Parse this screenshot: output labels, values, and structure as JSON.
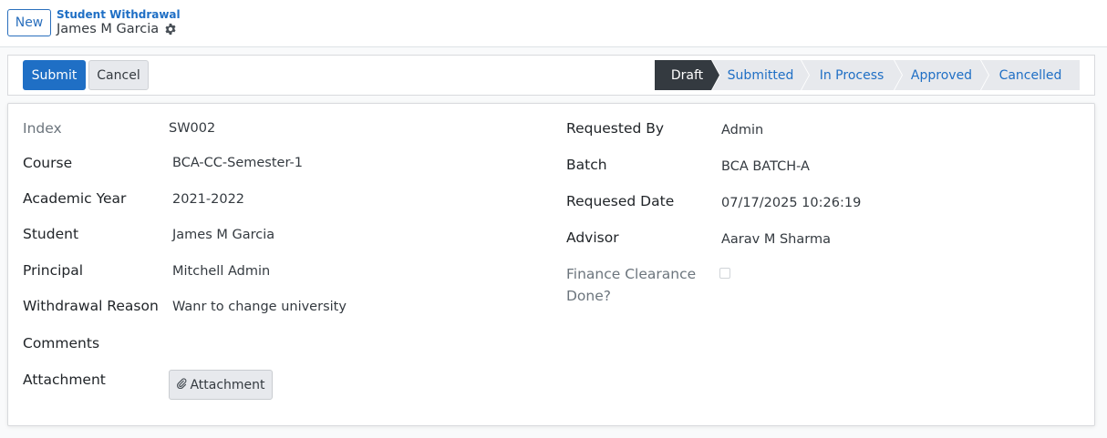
{
  "header": {
    "new_label": "New",
    "breadcrumb": "Student Withdrawal",
    "record_title": "James M Garcia"
  },
  "actions": {
    "submit_label": "Submit",
    "cancel_label": "Cancel"
  },
  "stages": [
    "Draft",
    "Submitted",
    "In Process",
    "Approved",
    "Cancelled"
  ],
  "active_stage": "Draft",
  "form": {
    "left": {
      "index_label": "Index",
      "index_value": "SW002",
      "course_label": "Course",
      "course_value": "BCA-CC-Semester-1",
      "year_label": "Academic Year",
      "year_value": "2021-2022",
      "student_label": "Student",
      "student_value": "James M Garcia",
      "principal_label": "Principal",
      "principal_value": "Mitchell Admin",
      "reason_label": "Withdrawal Reason",
      "reason_value": "Wanr to change university",
      "comments_label": "Comments",
      "attachment_label": "Attachment",
      "attachment_button": "Attachment"
    },
    "right": {
      "requested_by_label": "Requested By",
      "requested_by_value": "Admin",
      "batch_label": "Batch",
      "batch_value": "BCA BATCH-A",
      "date_label": "Requesed Date",
      "date_value": "07/17/2025 10:26:19",
      "advisor_label": "Advisor",
      "advisor_value": "Aarav M Sharma",
      "finance_label_line1": "Finance Clearance",
      "finance_label_line2": "Done?",
      "finance_checked": false
    }
  },
  "icons": {
    "gear": "gear-icon",
    "paperclip": "paperclip-icon"
  },
  "colors": {
    "primary": "#1f6fc5",
    "active_stage": "#343a40"
  }
}
